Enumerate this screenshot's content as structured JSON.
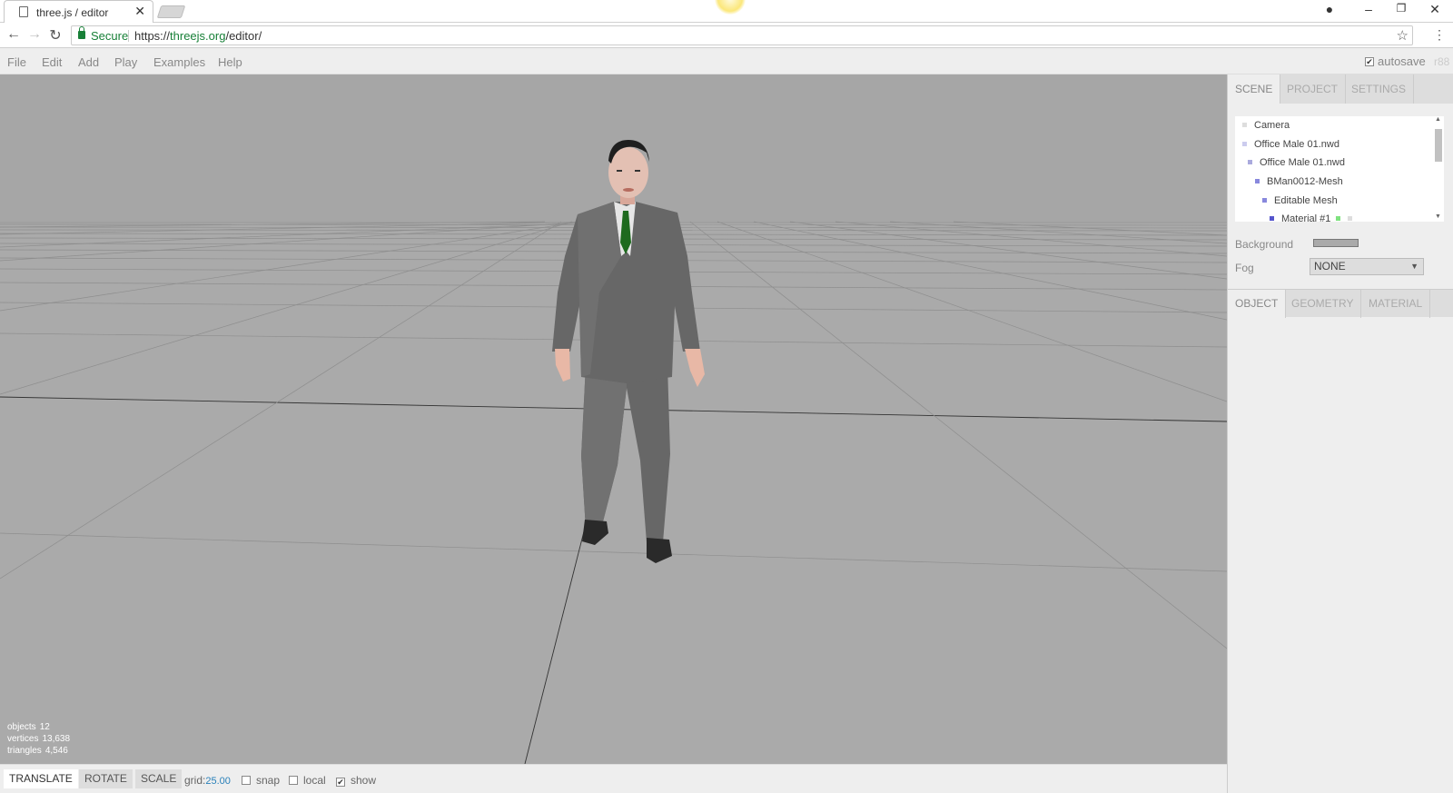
{
  "browser": {
    "tab_title": "three.js / editor",
    "secure_label": "Secure",
    "url_scheme": "https://",
    "url_host": "threejs.org",
    "url_path": "/editor/"
  },
  "menubar": {
    "items": [
      "File",
      "Edit",
      "Add",
      "Play",
      "Examples",
      "Help"
    ],
    "autosave_label": "autosave",
    "autosave_checked": true,
    "revision": "r88"
  },
  "viewport": {
    "info": {
      "objects_label": "objects",
      "objects_value": "12",
      "vertices_label": "vertices",
      "vertices_value": "13,638",
      "triangles_label": "triangles",
      "triangles_value": "4,546"
    }
  },
  "toolbar": {
    "translate": "TRANSLATE",
    "rotate": "ROTATE",
    "scale": "SCALE",
    "grid_label": "grid:",
    "grid_value": "25.00",
    "snap_label": "snap",
    "snap_checked": false,
    "local_label": "local",
    "local_checked": false,
    "show_label": "show",
    "show_checked": true
  },
  "sidebar": {
    "tabs": [
      "SCENE",
      "PROJECT",
      "SETTINGS"
    ],
    "outliner": [
      {
        "label": "Camera",
        "dot": "#dddddd"
      },
      {
        "label": "Office Male 01.nwd",
        "dot": "#ccccee"
      },
      {
        "label": "Office Male 01.nwd",
        "dot": "#aaaadd"
      },
      {
        "label": "BMan0012-Mesh",
        "dot": "#8888dd"
      },
      {
        "label": "Editable Mesh",
        "dot": "#8888dd"
      },
      {
        "label": "Material #1",
        "dot": "#5555cc"
      }
    ],
    "background_label": "Background",
    "fog_label": "Fog",
    "fog_value": "NONE",
    "property_tabs": [
      "OBJECT",
      "GEOMETRY",
      "MATERIAL"
    ]
  }
}
